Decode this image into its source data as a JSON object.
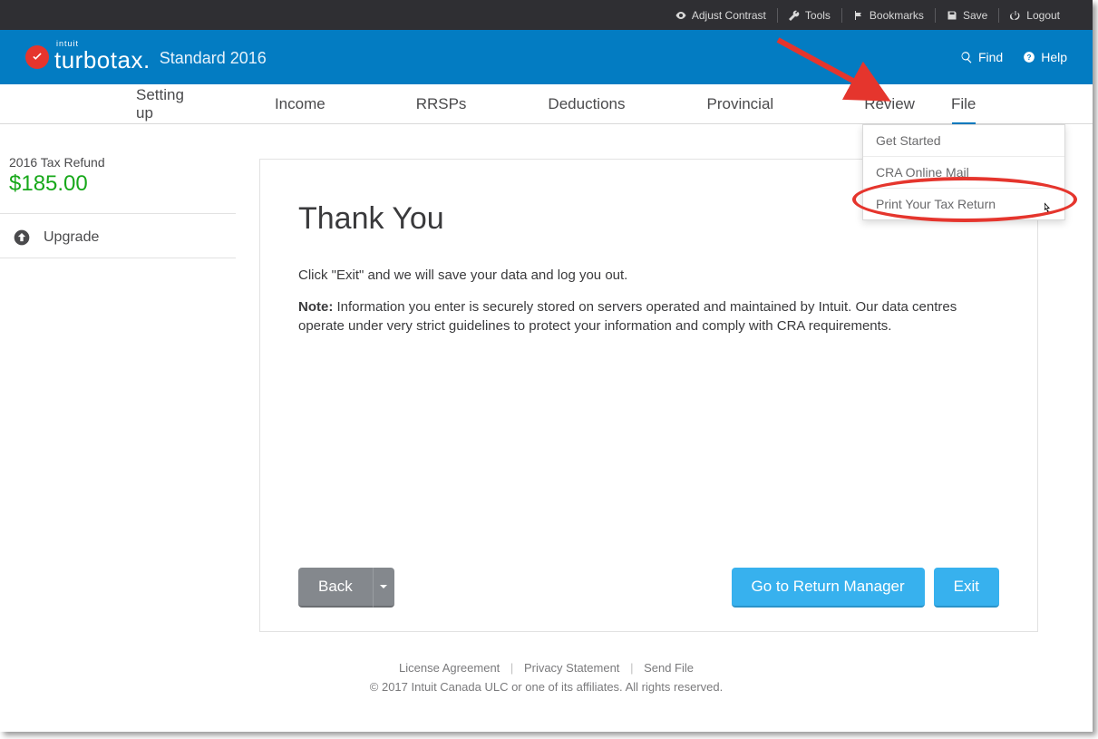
{
  "util": {
    "contrast": "Adjust Contrast",
    "tools": "Tools",
    "bookmarks": "Bookmarks",
    "save": "Save",
    "logout": "Logout"
  },
  "brand": {
    "intuit": "intuit",
    "name": "turbotax",
    "sub": "Standard 2016",
    "find": "Find",
    "help": "Help"
  },
  "nav": {
    "setting_up": "Setting up",
    "income": "Income",
    "rrsps": "RRSPs",
    "deductions": "Deductions",
    "provincial": "Provincial",
    "review": "Review",
    "file": "File"
  },
  "dropdown": {
    "get_started": "Get Started",
    "cra_mail": "CRA Online Mail",
    "print": "Print Your Tax Return"
  },
  "sidebar": {
    "refund_label": "2016 Tax Refund",
    "refund_amount": "$185.00",
    "upgrade": "Upgrade"
  },
  "panel": {
    "title": "Thank You",
    "p1": "Click \"Exit\" and we will save your data and log you out.",
    "note_label": "Note:",
    "note_body": " Information you enter is securely stored on servers operated and maintained by Intuit. Our data centres operate under very strict guidelines to protect your information and comply with CRA requirements.",
    "back": "Back",
    "return_mgr": "Go to Return Manager",
    "exit": "Exit"
  },
  "footer": {
    "license": "License Agreement",
    "privacy": "Privacy Statement",
    "send_file": "Send File",
    "copyright": "© 2017 Intuit Canada ULC or one of its affiliates. All rights reserved."
  }
}
